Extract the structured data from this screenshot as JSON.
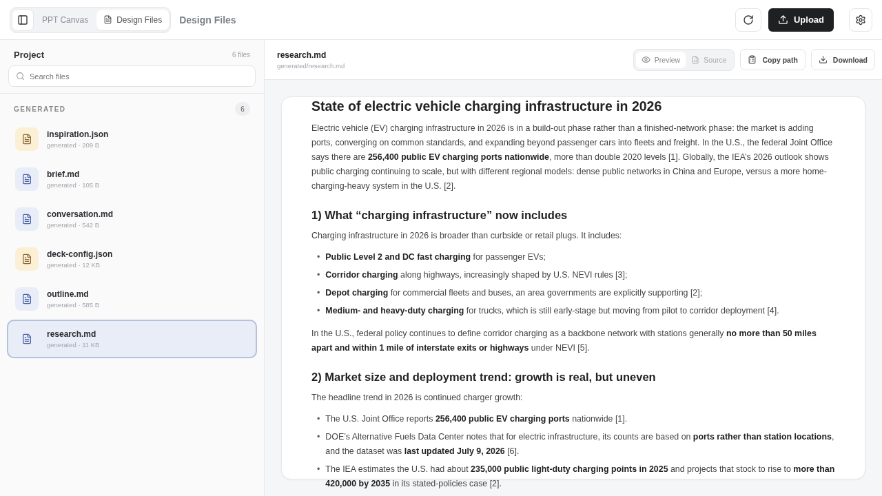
{
  "topbar": {
    "tabs": [
      {
        "label": "PPT Canvas",
        "selected": false
      },
      {
        "label": "Design Files",
        "selected": true
      }
    ],
    "title": "Design Files",
    "upload": "Upload"
  },
  "sidebar": {
    "title": "Project",
    "count": "6 files",
    "search": {
      "placeholder": "Search files"
    },
    "group": {
      "label": "GENERATED",
      "count": "6"
    },
    "files": [
      {
        "name": "inspiration.json",
        "meta": "generated · 209 B",
        "kind": "json",
        "selected": false
      },
      {
        "name": "brief.md",
        "meta": "generated · 105 B",
        "kind": "md",
        "selected": false
      },
      {
        "name": "conversation.md",
        "meta": "generated · 542 B",
        "kind": "md",
        "selected": false
      },
      {
        "name": "deck-config.json",
        "meta": "generated · 12 KB",
        "kind": "json",
        "selected": false
      },
      {
        "name": "outline.md",
        "meta": "generated · 585 B",
        "kind": "md",
        "selected": false
      },
      {
        "name": "research.md",
        "meta": "generated · 11 KB",
        "kind": "md",
        "selected": true
      }
    ]
  },
  "file": {
    "name": "research.md",
    "path": "generated/research.md",
    "views": [
      {
        "label": "Preview",
        "selected": true
      },
      {
        "label": "Source",
        "selected": false
      }
    ],
    "copy": "Copy path",
    "download": "Download"
  },
  "document": [
    {
      "kind": "h1",
      "text": "State of electric vehicle charging infrastructure in 2026"
    },
    {
      "kind": "p",
      "text": "Electric vehicle (EV) charging infrastructure in 2026 is in a build-out phase rather than a finished-network phase: the market is adding ports, converging on common standards, and expanding beyond passenger cars into fleets and freight. In the U.S., the federal Joint Office says there are **256,400 public EV charging ports nationwide**, more than double 2020 levels [1]. Globally, the IEA’s 2026 outlook shows public charging continuing to scale, but with different regional models: dense public networks in China and Europe, versus a more home-charging-heavy system in the U.S. [2]."
    },
    {
      "kind": "h2",
      "text": "1) What “charging infrastructure” now includes"
    },
    {
      "kind": "p",
      "text": "Charging infrastructure in 2026 is broader than curbside or retail plugs. It includes:"
    },
    {
      "kind": "list",
      "marker": "•",
      "items": [
        "**Public Level 2 and DC fast charging** for passenger EVs;",
        "**Corridor charging** along highways, increasingly shaped by U.S. NEVI rules [3];",
        "**Depot charging** for commercial fleets and buses, an area governments are explicitly supporting [2];",
        "**Medium- and heavy-duty charging** for trucks, which is still early-stage but moving from pilot to corridor deployment [4]."
      ]
    },
    {
      "kind": "p",
      "text": "In the U.S., federal policy continues to define corridor charging as a backbone network with stations generally **no more than 50 miles apart and within 1 mile of interstate exits or highways** under NEVI [5]."
    },
    {
      "kind": "h2",
      "text": "2) Market size and deployment trend: growth is real, but uneven"
    },
    {
      "kind": "p",
      "text": "The headline trend in 2026 is continued charger growth:"
    },
    {
      "kind": "list",
      "marker": "•",
      "items": [
        "The U.S. Joint Office reports **256,400 public EV charging ports** nationwide [1].",
        "DOE’s Alternative Fuels Data Center notes that for electric infrastructure, its counts are based on **ports rather than station locations**, and the dataset was **last updated July 9, 2026** [6].",
        "The IEA estimates the U.S. had about **235,000 public light-duty charging points in 2025** and projects that stock to rise to **more than 420,000 by 2035** in its stated-policies case [2]."
      ]
    }
  ]
}
